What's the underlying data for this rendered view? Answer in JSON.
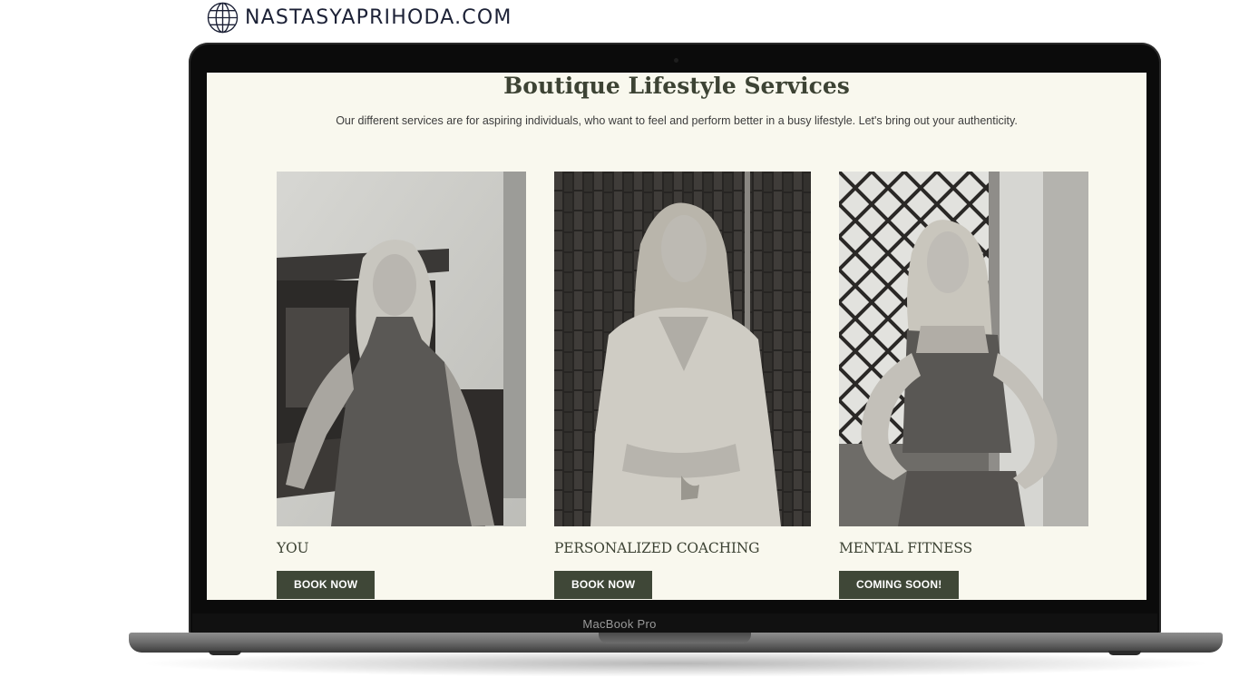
{
  "site_badge": {
    "icon": "globe-icon",
    "domain": "NASTASYAPRIHODA.COM",
    "color": "#1c2136"
  },
  "device": {
    "brand_label": "MacBook Pro"
  },
  "page": {
    "title": "Boutique Lifestyle Services",
    "subtitle": "Our different services are for aspiring individuals, who want to feel and perform better in a busy lifestyle. Let's bring out your authenticity.",
    "background_color": "#f9f8ee",
    "accent_color": "#3f4737",
    "services": [
      {
        "title": "YOU",
        "button_label": "BOOK NOW",
        "photo": "woman-seated-by-piano-photo"
      },
      {
        "title": "PERSONALIZED COACHING",
        "button_label": "BOOK NOW",
        "photo": "woman-seated-in-silk-shirt-photo"
      },
      {
        "title": "MENTAL FITNESS",
        "button_label": "COMING SOON!",
        "photo": "woman-standing-in-sportswear-photo"
      }
    ]
  }
}
